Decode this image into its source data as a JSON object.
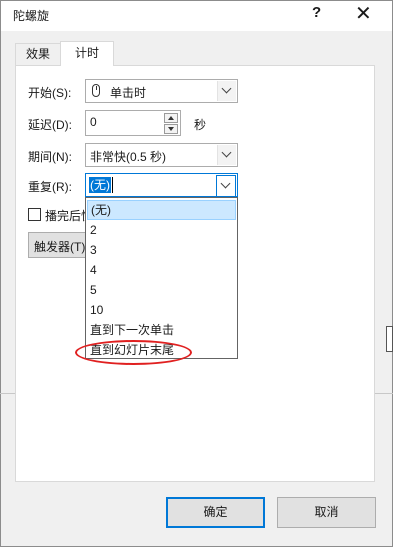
{
  "window": {
    "title": "陀螺旋",
    "help_label": "?",
    "close_label": "✕"
  },
  "tabs": [
    {
      "label": "效果",
      "active": false
    },
    {
      "label": "计时",
      "active": true
    }
  ],
  "fields": {
    "start": {
      "label": "开始(S):",
      "value": "单击时",
      "icon": "mouse-icon"
    },
    "delay": {
      "label": "延迟(D):",
      "value": "0",
      "unit": "秒"
    },
    "period": {
      "label": "期间(N):",
      "value": "非常快(0.5 秒)"
    },
    "repeat": {
      "label": "重复(R):",
      "value": "(无)"
    }
  },
  "checkbox": {
    "label_visible": "播完后快",
    "checked": false
  },
  "trigger_button": {
    "label": "触发器(T)"
  },
  "dropdown": {
    "options": [
      "(无)",
      "2",
      "3",
      "4",
      "5",
      "10",
      "直到下一次单击",
      "直到幻灯片末尾"
    ],
    "selected_index": 0,
    "highlighted_option": "直到幻灯片末尾"
  },
  "buttons": {
    "ok": "确定",
    "cancel": "取消"
  },
  "colors": {
    "accent": "#0078d7",
    "annotation": "#e02020",
    "selected_bg": "#cce8ff"
  }
}
